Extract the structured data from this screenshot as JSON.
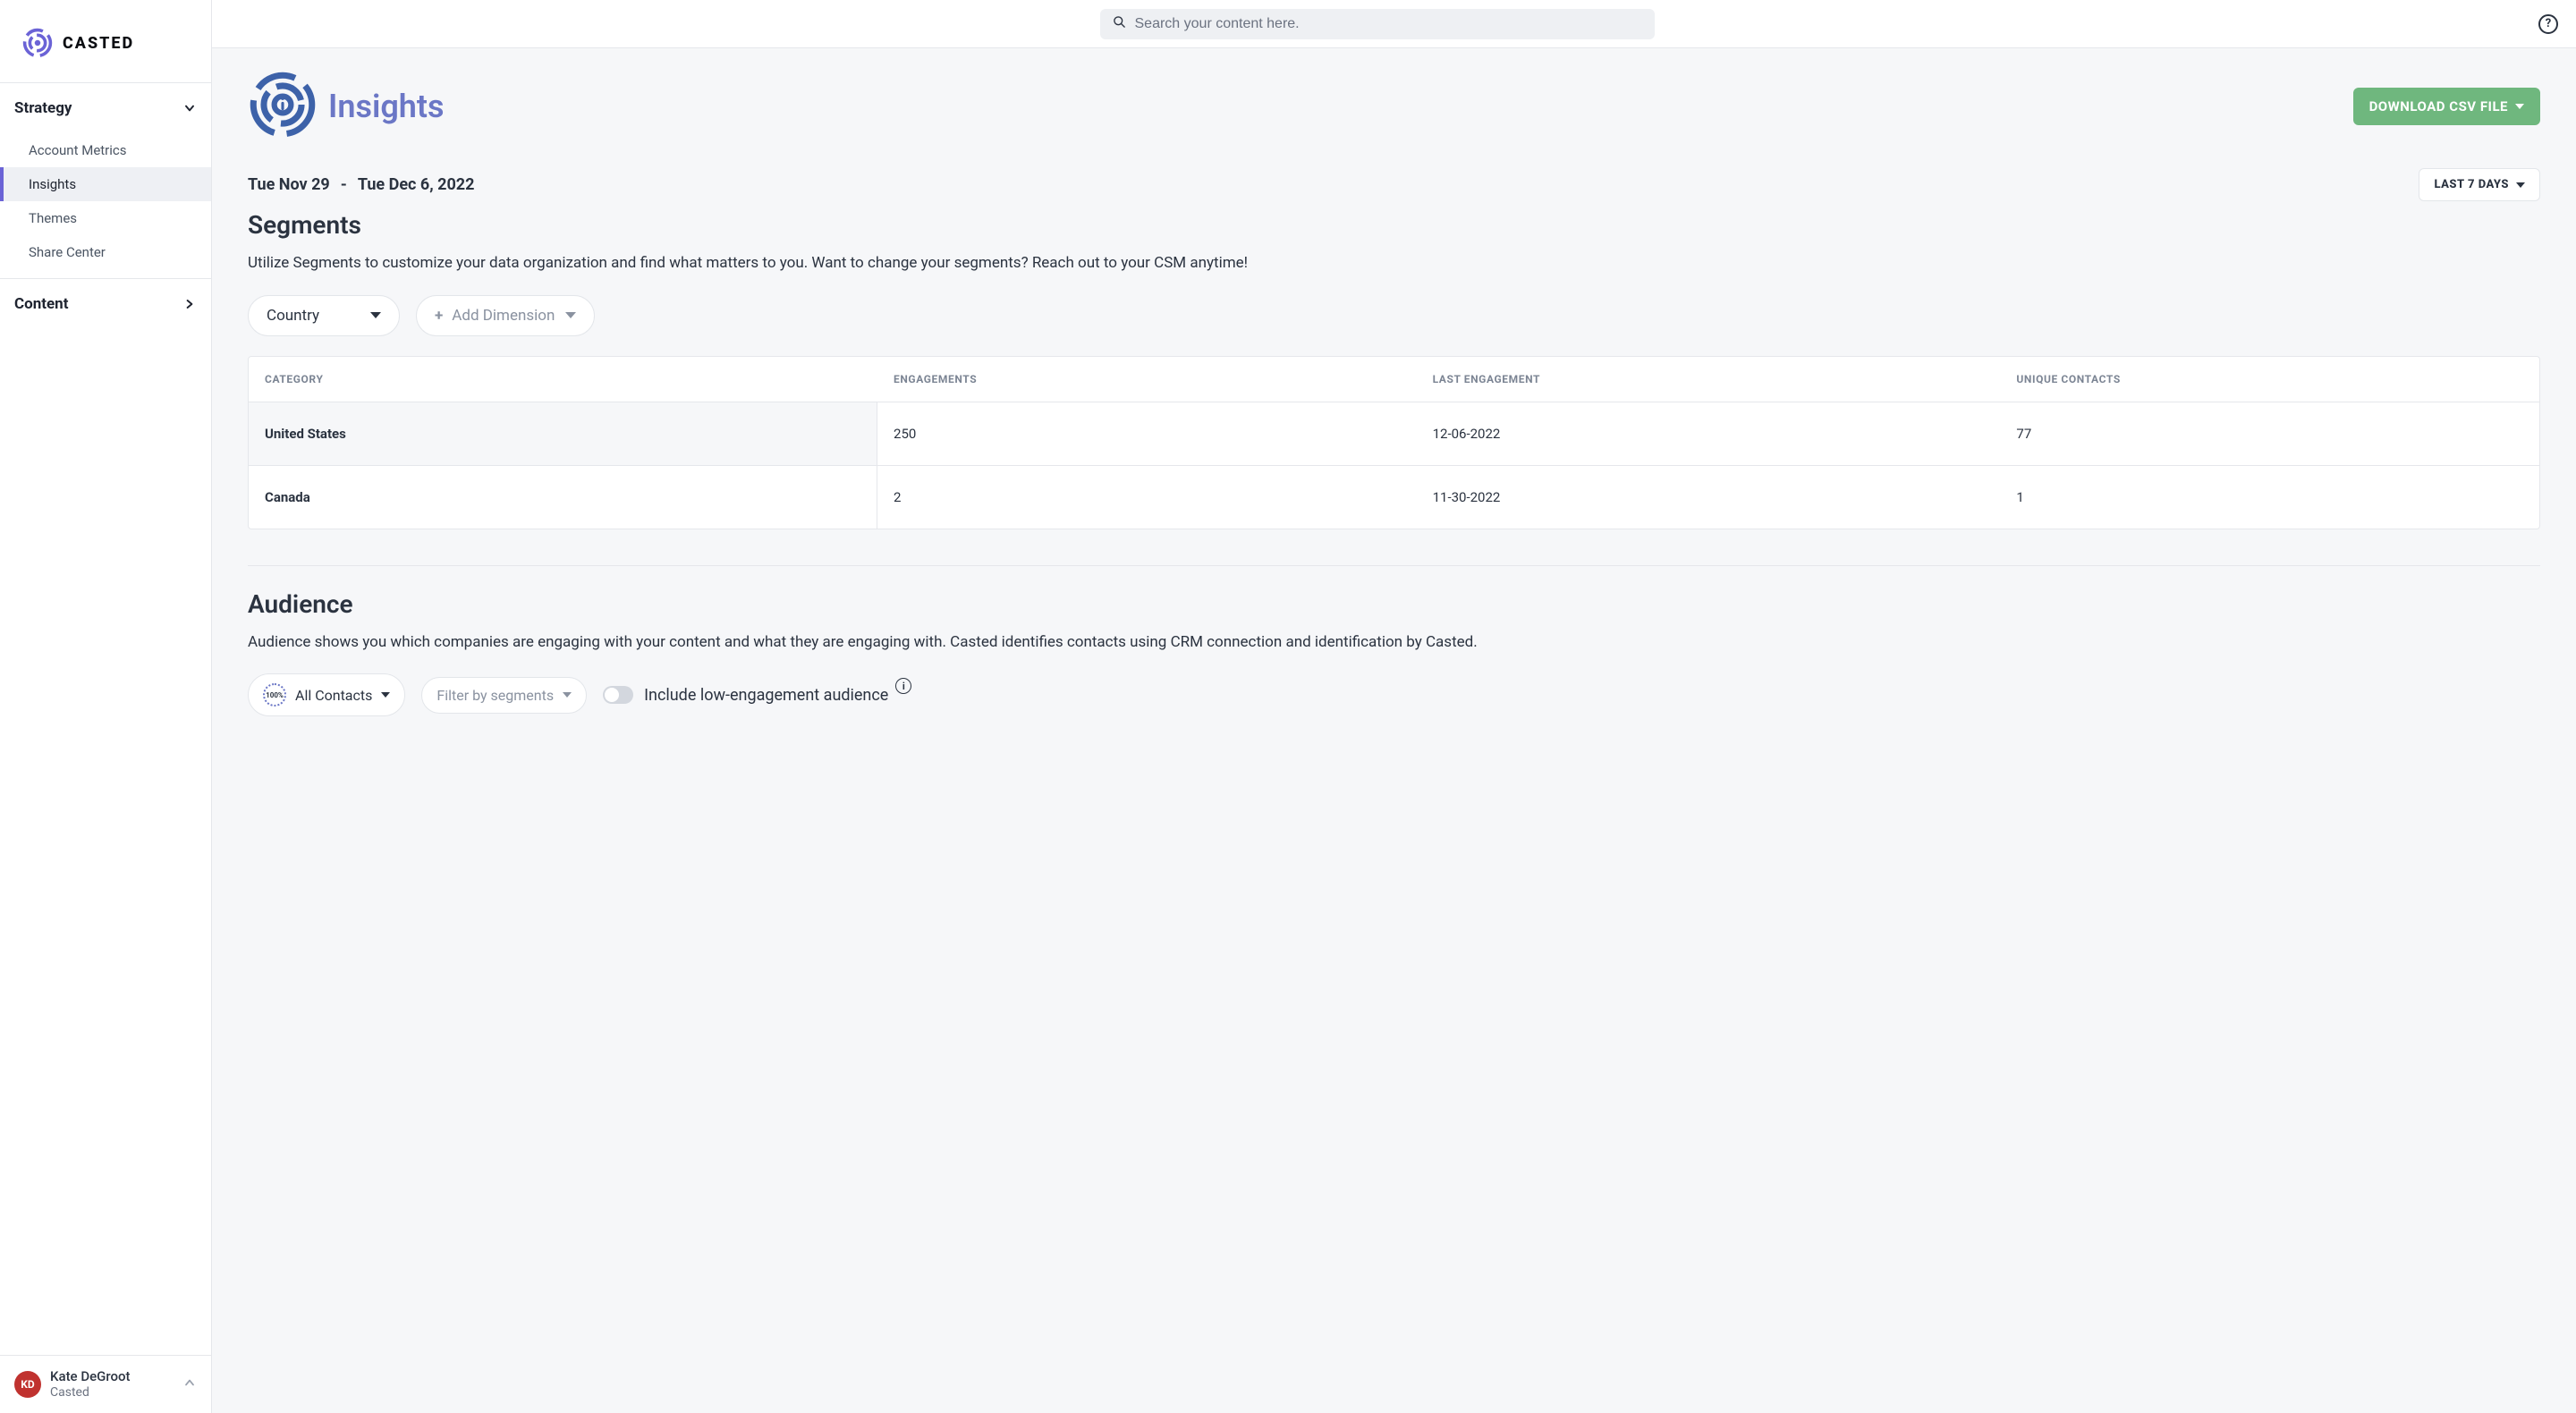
{
  "brand": {
    "name": "CASTED"
  },
  "search": {
    "placeholder": "Search your content here."
  },
  "sidebar": {
    "sections": [
      {
        "title": "Strategy",
        "expanded": true,
        "items": [
          {
            "label": "Account Metrics",
            "active": false
          },
          {
            "label": "Insights",
            "active": true
          },
          {
            "label": "Themes",
            "active": false
          },
          {
            "label": "Share Center",
            "active": false
          }
        ]
      },
      {
        "title": "Content",
        "expanded": false,
        "items": []
      }
    ],
    "user": {
      "initials": "KD",
      "name": "Kate DeGroot",
      "org": "Casted"
    }
  },
  "page": {
    "title": "Insights",
    "download_label": "DOWNLOAD CSV FILE",
    "date_range": {
      "start": "Tue Nov 29",
      "end": "Tue Dec 6, 2022",
      "preset": "LAST 7 DAYS"
    }
  },
  "segments": {
    "heading": "Segments",
    "description": "Utilize Segments to customize your data organization and find what matters to you. Want to change your segments? Reach out to your CSM anytime!",
    "dimension_selected": "Country",
    "add_dimension_label": "Add Dimension",
    "columns": [
      "CATEGORY",
      "ENGAGEMENTS",
      "LAST ENGAGEMENT",
      "UNIQUE CONTACTS"
    ],
    "rows": [
      {
        "category": "United States",
        "engagements": "250",
        "last_engagement": "12-06-2022",
        "unique_contacts": "77"
      },
      {
        "category": "Canada",
        "engagements": "2",
        "last_engagement": "11-30-2022",
        "unique_contacts": "1"
      }
    ]
  },
  "audience": {
    "heading": "Audience",
    "description": "Audience shows you which companies are engaging with your content and what they are engaging with. Casted identifies contacts using CRM connection and identification by Casted.",
    "contacts_filter": {
      "gauge_value": "100%",
      "label": "All Contacts"
    },
    "segment_filter_placeholder": "Filter by segments",
    "low_engagement_label": "Include low-engagement audience"
  }
}
